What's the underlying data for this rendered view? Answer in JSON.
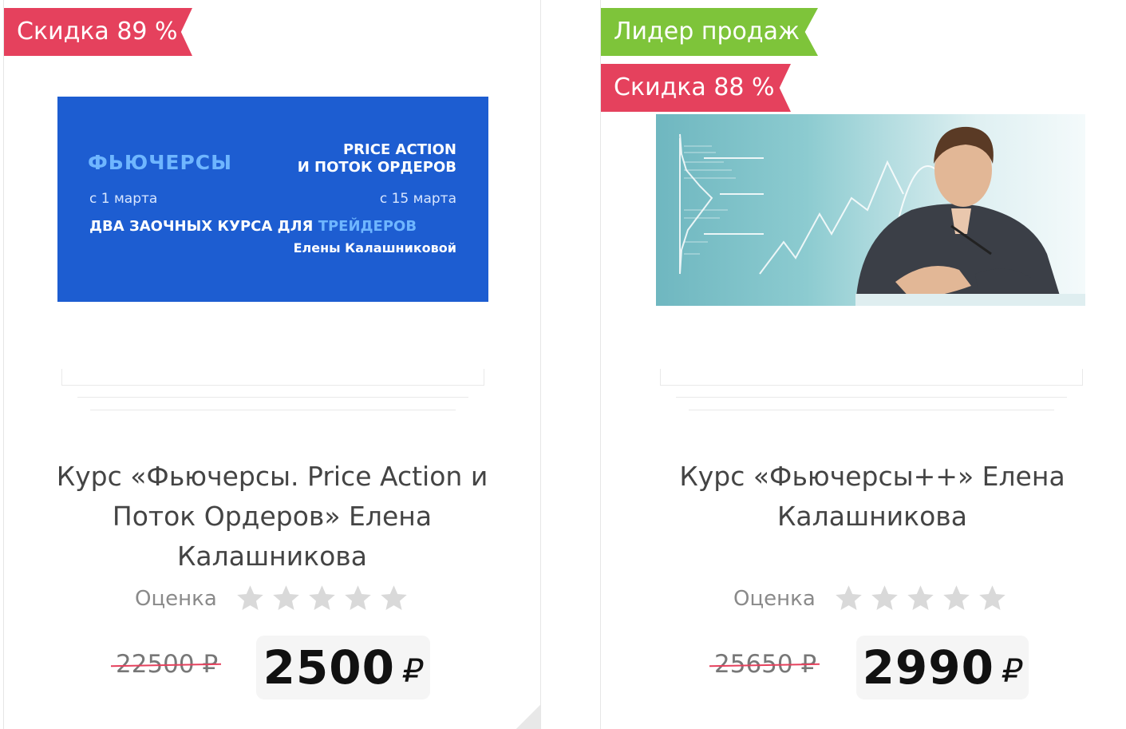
{
  "cards": [
    {
      "badges": {
        "discount": "Скидка 89 %"
      },
      "banner": {
        "futures": "ФЬЮЧЕРСЫ",
        "price_action": "PRICE ACTION",
        "order_flow": "И ПОТОК ОРДЕРОВ",
        "date_left": "с 1 марта",
        "date_right": "с 15 марта",
        "two_courses": "ДВА ЗАОЧНЫХ КУРСА ДЛЯ",
        "traders": "ТРЕЙДЕРОВ",
        "author": "Елены Калашниковой"
      },
      "title": "Курс «Фьючерсы. Price Action и Поток Ордеров» Елена Калашникова",
      "rating_label": "Оценка",
      "rating": 0,
      "old_price": "22500 ₽",
      "price": "2500",
      "currency": "₽"
    },
    {
      "badges": {
        "leader": "Лидер продаж",
        "discount": "Скидка 88 %"
      },
      "title": "Курс «Фьючерсы++» Елена Калашникова",
      "rating_label": "Оценка",
      "rating": 0,
      "old_price": "25650 ₽",
      "price": "2990",
      "currency": "₽"
    }
  ],
  "colors": {
    "discount": "#e5415d",
    "leader": "#7ec43a",
    "star_empty": "#d9d9d9"
  },
  "icons": {
    "star": "star-icon"
  }
}
